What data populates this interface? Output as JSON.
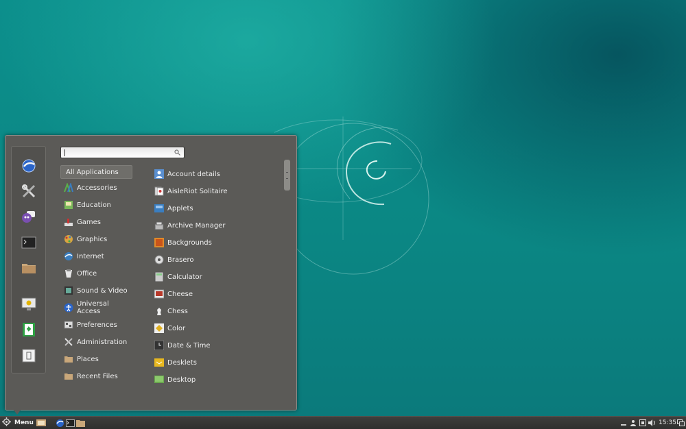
{
  "menu": {
    "search_placeholder": "",
    "categories": [
      {
        "label": "All Applications",
        "icon": "none",
        "selected": true
      },
      {
        "label": "Accessories",
        "icon": "accessories-icon"
      },
      {
        "label": "Education",
        "icon": "education-icon"
      },
      {
        "label": "Games",
        "icon": "games-icon"
      },
      {
        "label": "Graphics",
        "icon": "graphics-icon"
      },
      {
        "label": "Internet",
        "icon": "internet-icon"
      },
      {
        "label": "Office",
        "icon": "office-icon"
      },
      {
        "label": "Sound & Video",
        "icon": "sound-video-icon"
      },
      {
        "label": "Universal Access",
        "icon": "universal-access-icon"
      },
      {
        "label": "Preferences",
        "icon": "preferences-icon"
      },
      {
        "label": "Administration",
        "icon": "administration-icon"
      },
      {
        "label": "Places",
        "icon": "places-folder-icon"
      },
      {
        "label": "Recent Files",
        "icon": "recent-files-folder-icon"
      }
    ],
    "apps": [
      {
        "label": "Account details",
        "icon": "account-details-icon"
      },
      {
        "label": "AisleRiot Solitaire",
        "icon": "solitaire-icon"
      },
      {
        "label": "Applets",
        "icon": "applets-icon"
      },
      {
        "label": "Archive Manager",
        "icon": "archive-manager-icon"
      },
      {
        "label": "Backgrounds",
        "icon": "backgrounds-icon"
      },
      {
        "label": "Brasero",
        "icon": "brasero-icon"
      },
      {
        "label": "Calculator",
        "icon": "calculator-icon"
      },
      {
        "label": "Cheese",
        "icon": "cheese-icon"
      },
      {
        "label": "Chess",
        "icon": "chess-icon"
      },
      {
        "label": "Color",
        "icon": "color-icon"
      },
      {
        "label": "Date & Time",
        "icon": "date-time-icon"
      },
      {
        "label": "Desklets",
        "icon": "desklets-icon"
      },
      {
        "label": "Desktop",
        "icon": "desktop-icon"
      }
    ],
    "favorites": [
      "web-browser-icon",
      "system-settings-icon",
      "chat-icon",
      "terminal-icon",
      "files-folder-icon",
      "lock-screen-icon",
      "logout-icon",
      "shutdown-icon"
    ]
  },
  "panel": {
    "menu_label": "Menu",
    "clock": "15:35"
  },
  "colors": {
    "menu_bg": "#5b5a57",
    "panel_bg": "#353533",
    "desktop": "#0b8784"
  }
}
